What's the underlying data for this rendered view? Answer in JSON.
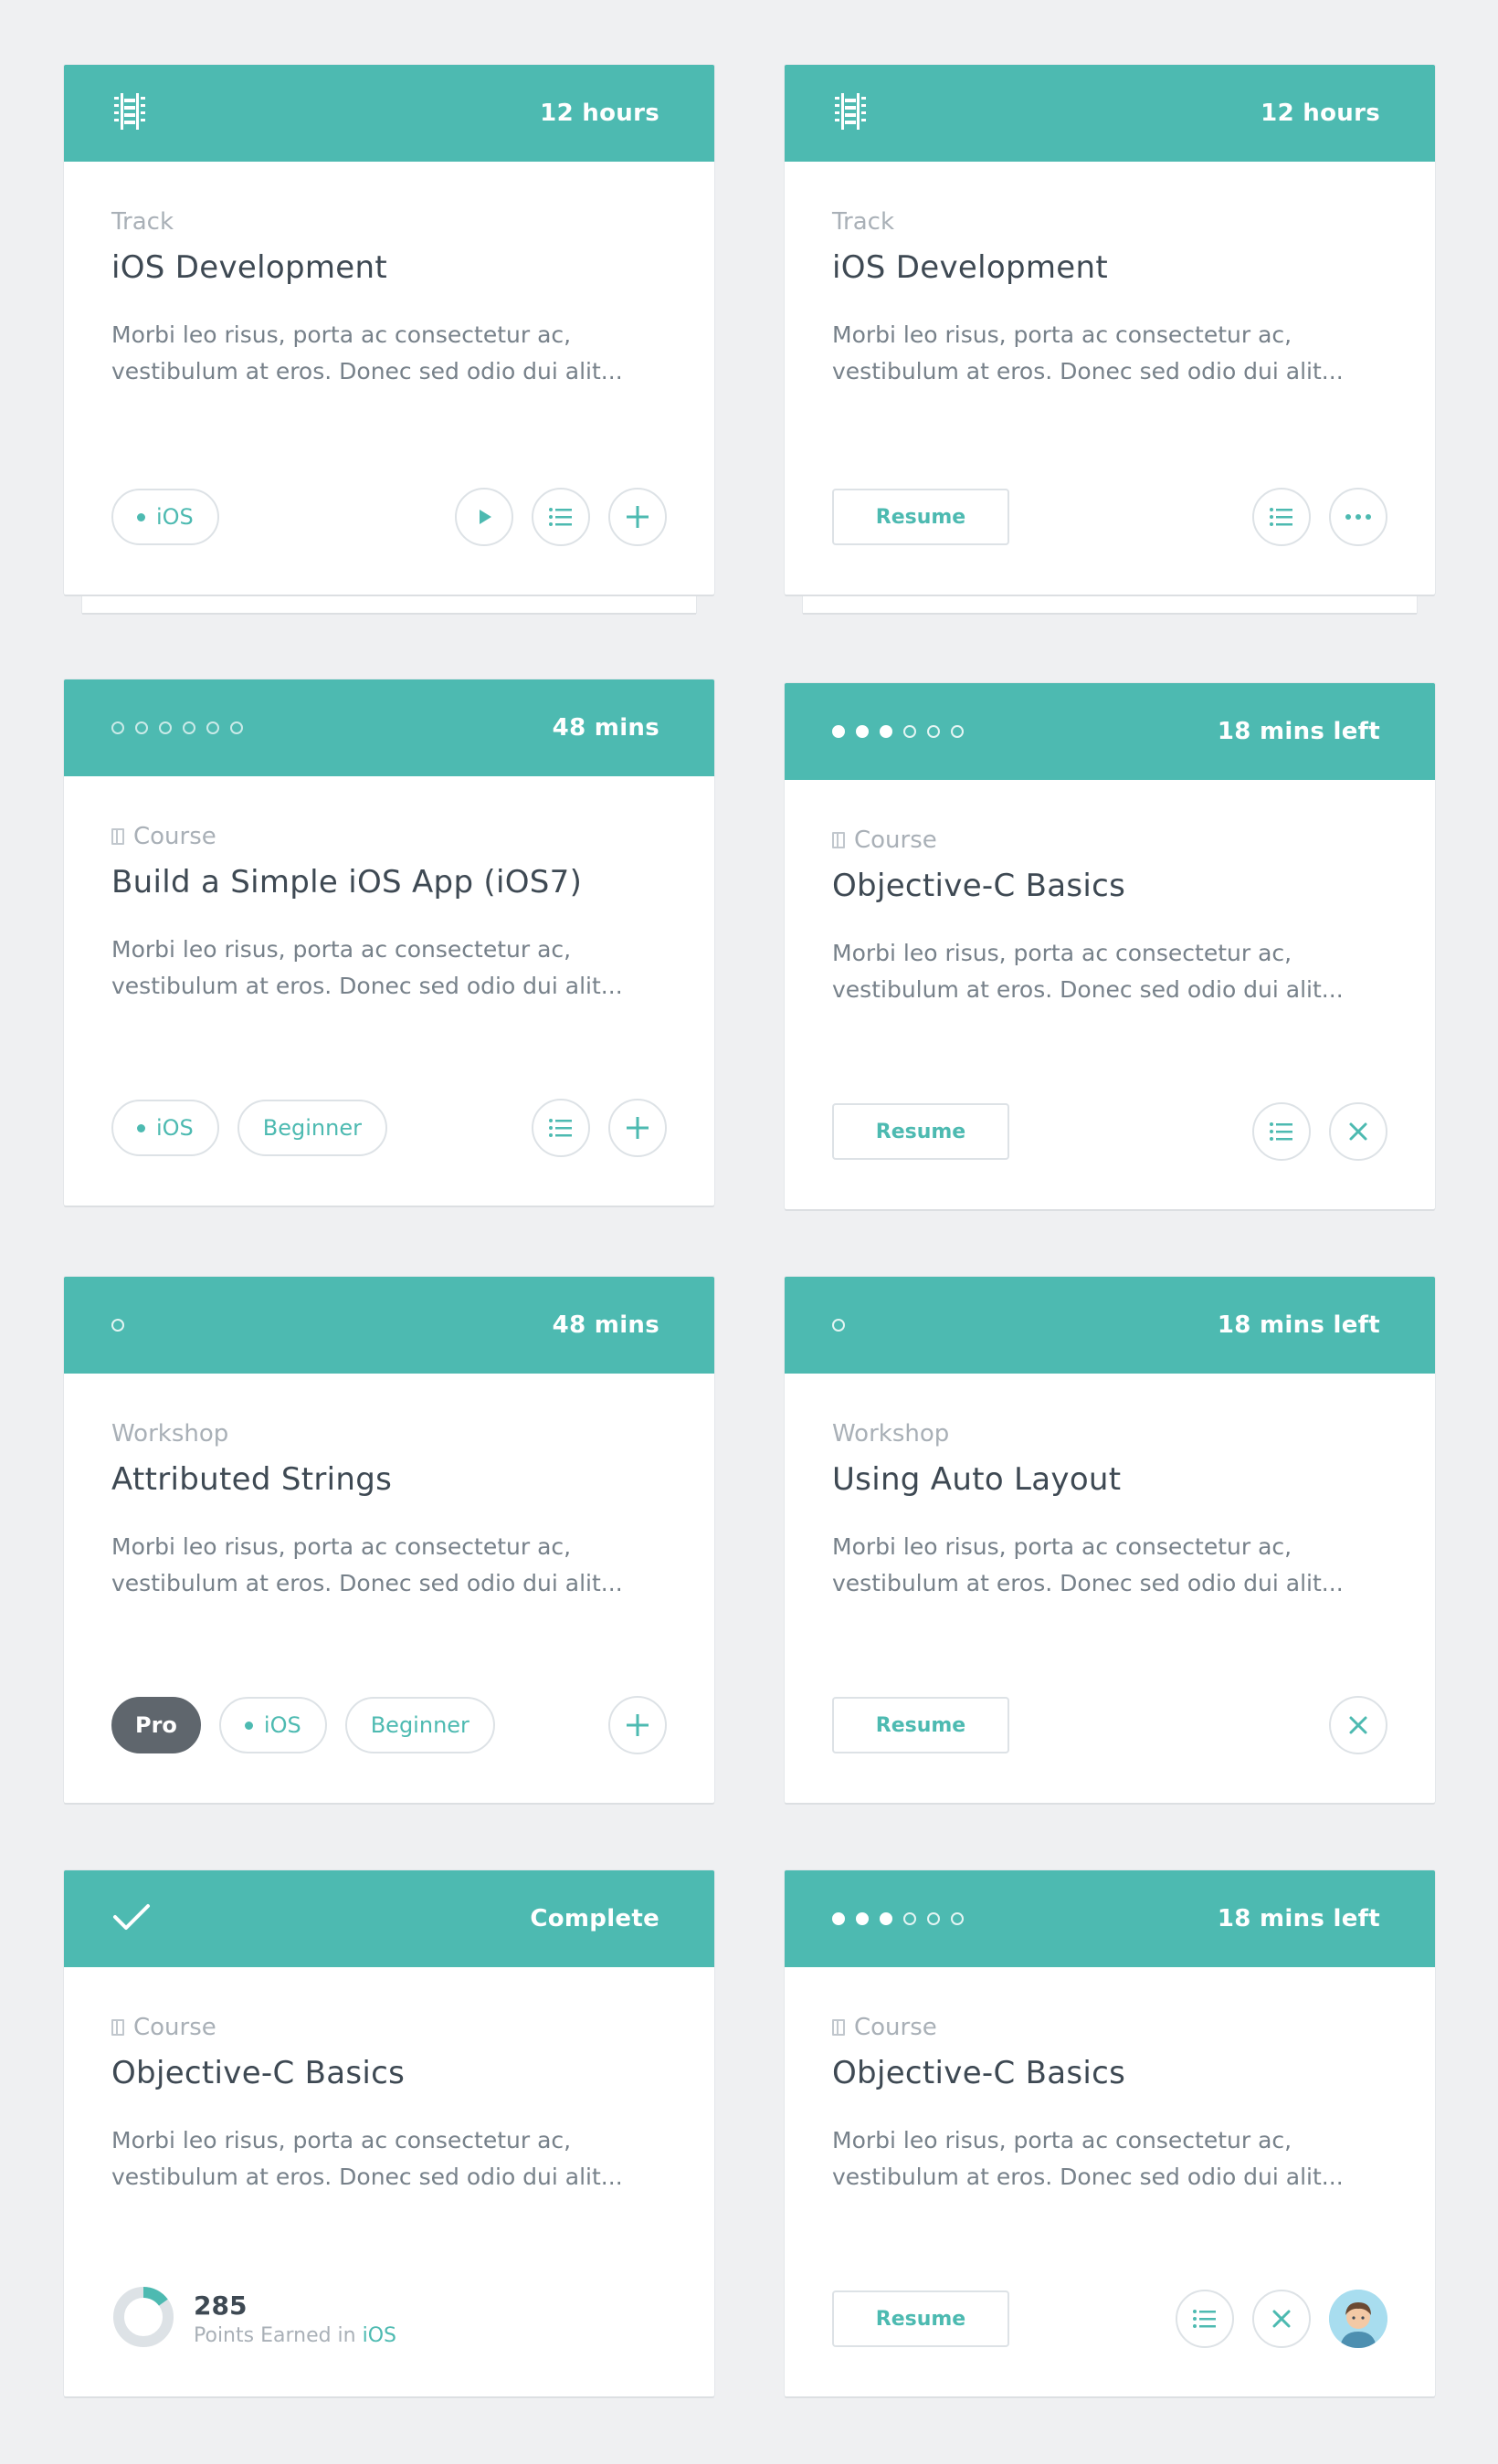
{
  "colors": {
    "accent": "#4dbab1",
    "pro_badge": "#5f666d",
    "background": "#eff0f2"
  },
  "cards": [
    {
      "header_icon": "film-strip-icon",
      "header_right": "12 hours",
      "kicker": "Track",
      "title": "iOS Development",
      "description": "Morbi leo risus, porta ac consectetur ac, vestibulum at eros. Donec sed odio dui alit...",
      "tags": [
        "iOS"
      ],
      "actions": [
        "play-icon",
        "list-icon",
        "plus-icon"
      ]
    },
    {
      "header_icon": "film-strip-icon",
      "header_right": "12 hours",
      "kicker": "Track",
      "title": "iOS Development",
      "description": "Morbi leo risus, porta ac consectetur ac, vestibulum at eros. Donec sed odio dui alit...",
      "resume_label": "Resume",
      "actions": [
        "list-icon",
        "more-icon"
      ]
    },
    {
      "progress": {
        "total": 6,
        "completed": 0
      },
      "header_right": "48 mins",
      "kicker": "Course",
      "title": "Build a Simple iOS App (iOS7)",
      "description": "Morbi leo risus, porta ac consectetur ac, vestibulum at eros. Donec sed odio dui alit...",
      "tags": [
        "iOS",
        "Beginner"
      ],
      "actions": [
        "list-icon",
        "plus-icon"
      ]
    },
    {
      "progress": {
        "total": 6,
        "completed": 3
      },
      "header_right": "18 mins left",
      "kicker": "Course",
      "title": "Objective-C Basics",
      "description": "Morbi leo risus, porta ac consectetur ac, vestibulum at eros. Donec sed odio dui alit...",
      "resume_label": "Resume",
      "actions": [
        "list-icon",
        "close-icon"
      ]
    },
    {
      "progress": {
        "total": 1,
        "completed": 0
      },
      "header_right": "48 mins",
      "kicker": "Workshop",
      "title": "Attributed Strings",
      "description": "Morbi leo risus, porta ac consectetur ac, vestibulum at eros. Donec sed odio dui alit...",
      "badge": "Pro",
      "tags": [
        "iOS",
        "Beginner"
      ],
      "actions": [
        "plus-icon"
      ]
    },
    {
      "progress": {
        "total": 1,
        "completed": 0
      },
      "header_right": "18 mins left",
      "kicker": "Workshop",
      "title": "Using Auto Layout",
      "description": "Morbi leo risus, porta ac consectetur ac, vestibulum at eros. Donec sed odio dui alit...",
      "resume_label": "Resume",
      "actions": [
        "close-icon"
      ]
    },
    {
      "header_icon": "checkmark-icon",
      "header_right": "Complete",
      "kicker": "Course",
      "title": "Objective-C Basics",
      "description": "Morbi leo risus, porta ac consectetur ac, vestibulum at eros. Donec sed odio dui alit...",
      "points": {
        "value": "285",
        "label": "Points Earned in",
        "topic": "iOS",
        "ring_fraction": 0.15
      }
    },
    {
      "progress": {
        "total": 6,
        "completed": 3
      },
      "header_right": "18 mins left",
      "kicker": "Course",
      "title": "Objective-C Basics",
      "description": "Morbi leo risus, porta ac consectetur ac, vestibulum at eros. Donec sed odio dui alit...",
      "resume_label": "Resume",
      "actions": [
        "list-icon",
        "close-icon"
      ],
      "avatar": "user-avatar-icon"
    }
  ]
}
